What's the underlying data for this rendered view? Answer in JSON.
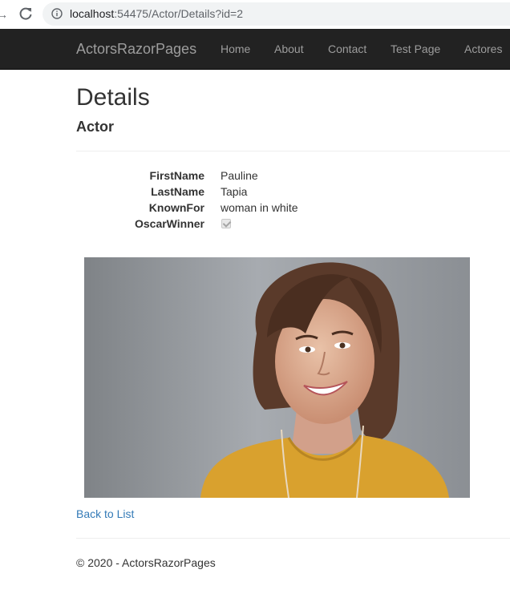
{
  "browser": {
    "url_host": "localhost",
    "url_path": ":54475/Actor/Details?id=2"
  },
  "navbar": {
    "brand": "ActorsRazorPages",
    "links": [
      "Home",
      "About",
      "Contact",
      "Test Page",
      "Actores"
    ]
  },
  "page": {
    "title": "Details",
    "subtitle": "Actor"
  },
  "details": [
    {
      "label": "FirstName",
      "value": "Pauline"
    },
    {
      "label": "LastName",
      "value": "Tapia"
    },
    {
      "label": "KnownFor",
      "value": "woman in white"
    },
    {
      "label": "OscarWinner",
      "checked": true
    }
  ],
  "back_link": "Back to List",
  "footer": "© 2020 - ActorsRazorPages",
  "colors": {
    "navbar_bg": "#222222",
    "nav_text": "#9d9d9d",
    "link": "#337ab7"
  },
  "icons": [
    "back-arrow-icon",
    "reload-icon",
    "info-icon"
  ]
}
